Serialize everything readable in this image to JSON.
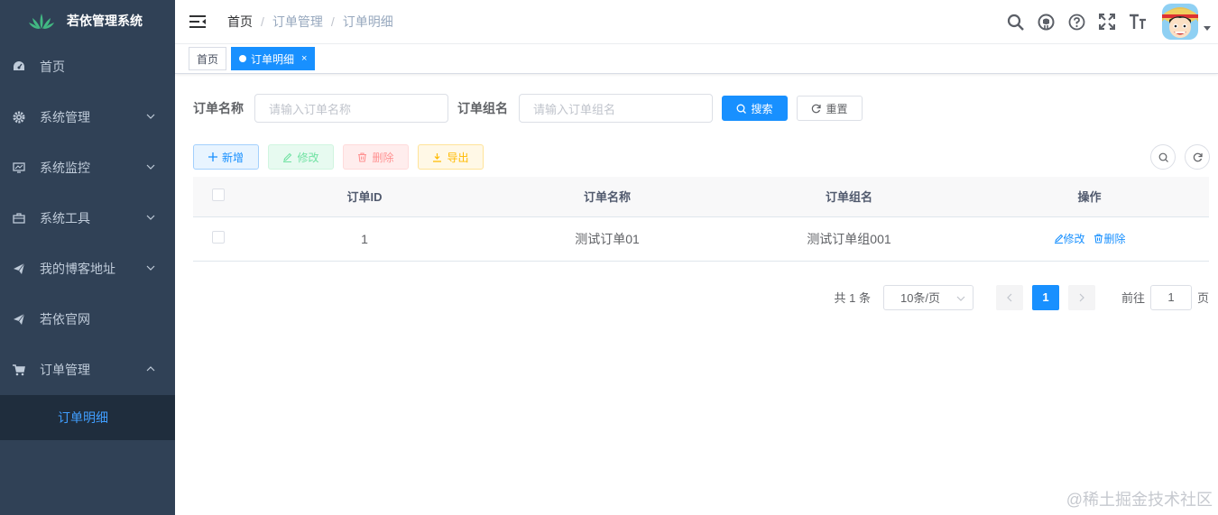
{
  "sidebar": {
    "logo_title": "若依管理系统",
    "items": [
      {
        "label": "首页",
        "icon": "dashboard-icon"
      },
      {
        "label": "系统管理",
        "icon": "gear-icon"
      },
      {
        "label": "系统监控",
        "icon": "monitor-icon"
      },
      {
        "label": "系统工具",
        "icon": "toolbox-icon"
      },
      {
        "label": "我的博客地址",
        "icon": "paper-plane-icon"
      },
      {
        "label": "若依官网",
        "icon": "paper-plane-icon"
      },
      {
        "label": "订单管理",
        "icon": "cart-icon"
      }
    ],
    "sub_item": "订单明细"
  },
  "navbar": {
    "breadcrumb": [
      "首页",
      "订单管理",
      "订单明细"
    ],
    "separator": "/"
  },
  "tags": {
    "home": "首页",
    "active": "订单明细",
    "close": "×"
  },
  "search": {
    "name_label": "订单名称",
    "name_placeholder": "请输入订单名称",
    "group_label": "订单组名",
    "group_placeholder": "请输入订单组名",
    "search_btn": "搜索",
    "reset_btn": "重置"
  },
  "toolbar": {
    "add": "新增",
    "edit": "修改",
    "delete": "删除",
    "export": "导出"
  },
  "table": {
    "headers": [
      "订单ID",
      "订单名称",
      "订单组名",
      "操作"
    ],
    "rows": [
      {
        "id": "1",
        "name": "测试订单01",
        "group": "测试订单组001",
        "edit": "修改",
        "delete": "删除"
      }
    ]
  },
  "pagination": {
    "total": "共 1 条",
    "page_size": "10条/页",
    "current_page": "1",
    "goto_label": "前往",
    "goto_value": "1",
    "page_suffix": "页"
  },
  "watermark": "@稀土掘金技术社区",
  "colors": {
    "sidebar_bg": "#304156",
    "submenu_bg": "#1f2d3d",
    "primary": "#1890ff",
    "active_text": "#409eff"
  }
}
